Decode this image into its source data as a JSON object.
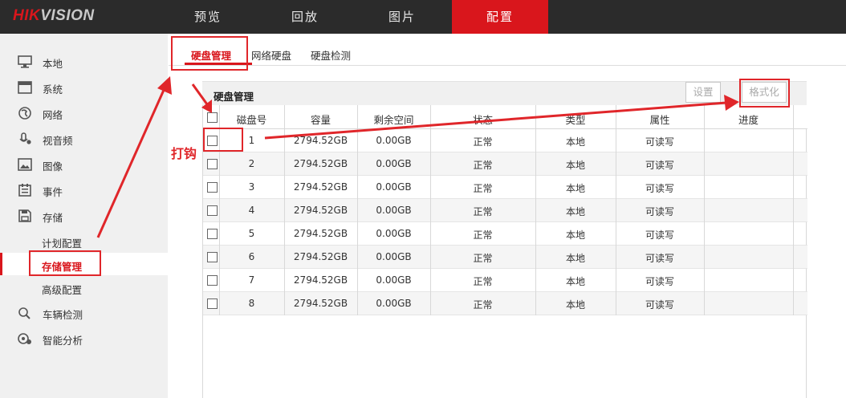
{
  "brand": {
    "part1": "HIK",
    "part2": "VISION"
  },
  "top_nav": [
    "预览",
    "回放",
    "图片",
    "配置"
  ],
  "sidebar": {
    "items": [
      {
        "label": "本地",
        "icon": "monitor-icon"
      },
      {
        "label": "系统",
        "icon": "system-window-icon"
      },
      {
        "label": "网络",
        "icon": "globe-icon"
      },
      {
        "label": "视音频",
        "icon": "microphone-icon"
      },
      {
        "label": "图像",
        "icon": "image-icon"
      },
      {
        "label": "事件",
        "icon": "calendar-list-icon"
      },
      {
        "label": "存储",
        "icon": "floppy-disk-icon"
      }
    ],
    "storage_sub": [
      "计划配置",
      "存储管理",
      "高级配置"
    ],
    "bottom_items": [
      {
        "label": "车辆检测",
        "icon": "vehicle-search-icon"
      },
      {
        "label": "智能分析",
        "icon": "smart-analysis-icon"
      }
    ]
  },
  "sub_tabs": [
    "硬盘管理",
    "网络硬盘",
    "硬盘检测"
  ],
  "panel": {
    "title": "硬盘管理",
    "settings_button": "设置",
    "format_button": "格式化"
  },
  "table": {
    "columns": [
      "磁盘号",
      "容量",
      "剩余空间",
      "状态",
      "类型",
      "属性",
      "进度"
    ],
    "rows": [
      [
        "1",
        "2794.52GB",
        "0.00GB",
        "正常",
        "本地",
        "可读写",
        ""
      ],
      [
        "2",
        "2794.52GB",
        "0.00GB",
        "正常",
        "本地",
        "可读写",
        ""
      ],
      [
        "3",
        "2794.52GB",
        "0.00GB",
        "正常",
        "本地",
        "可读写",
        ""
      ],
      [
        "4",
        "2794.52GB",
        "0.00GB",
        "正常",
        "本地",
        "可读写",
        ""
      ],
      [
        "5",
        "2794.52GB",
        "0.00GB",
        "正常",
        "本地",
        "可读写",
        ""
      ],
      [
        "6",
        "2794.52GB",
        "0.00GB",
        "正常",
        "本地",
        "可读写",
        ""
      ],
      [
        "7",
        "2794.52GB",
        "0.00GB",
        "正常",
        "本地",
        "可读写",
        ""
      ],
      [
        "8",
        "2794.52GB",
        "0.00GB",
        "正常",
        "本地",
        "可读写",
        ""
      ]
    ]
  },
  "annotation": {
    "check_label": "打钩"
  },
  "colors": {
    "accent": "#d9161c",
    "annotation": "#e0262a",
    "topbar": "#2b2b2b"
  }
}
